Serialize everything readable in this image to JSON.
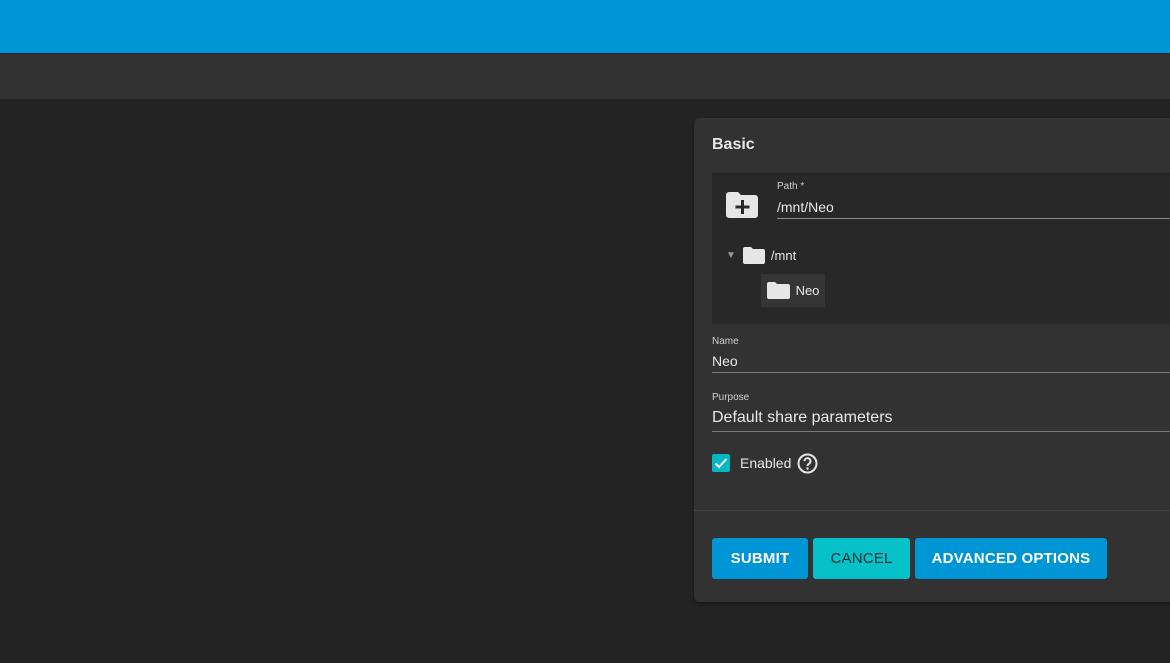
{
  "colors": {
    "topbar": "#0095d5",
    "subbar": "#333233",
    "background": "#232323",
    "card": "#333233",
    "primary": "#0095d5",
    "accent": "#07c1c9"
  },
  "form": {
    "section_title": "Basic",
    "path": {
      "label": "Path *",
      "value": "/mnt/Neo",
      "add_icon": "folder-plus-icon"
    },
    "tree": {
      "root_label": "/mnt",
      "root_expanded": true,
      "children": [
        {
          "label": "Neo"
        }
      ]
    },
    "name": {
      "label": "Name",
      "value": "Neo"
    },
    "purpose": {
      "label": "Purpose",
      "value": "Default share parameters"
    },
    "enabled": {
      "label": "Enabled",
      "checked": true,
      "help_icon": "help-circle-icon"
    },
    "buttons": {
      "submit": "SUBMIT",
      "cancel": "CANCEL",
      "advanced": "ADVANCED OPTIONS"
    }
  }
}
